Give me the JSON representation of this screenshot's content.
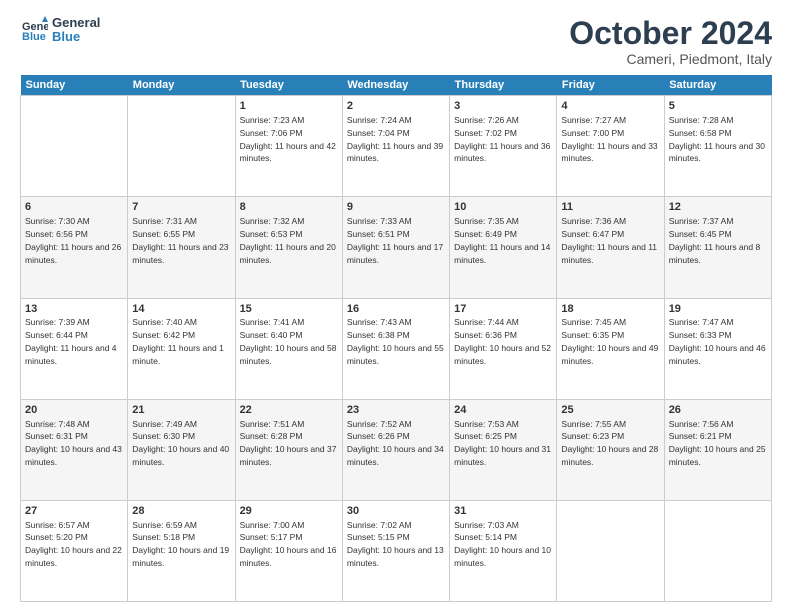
{
  "header": {
    "logo_line1": "General",
    "logo_line2": "Blue",
    "month_year": "October 2024",
    "location": "Cameri, Piedmont, Italy"
  },
  "weekdays": [
    "Sunday",
    "Monday",
    "Tuesday",
    "Wednesday",
    "Thursday",
    "Friday",
    "Saturday"
  ],
  "weeks": [
    [
      {
        "day": "",
        "sunrise": "",
        "sunset": "",
        "daylight": ""
      },
      {
        "day": "",
        "sunrise": "",
        "sunset": "",
        "daylight": ""
      },
      {
        "day": "1",
        "sunrise": "Sunrise: 7:23 AM",
        "sunset": "Sunset: 7:06 PM",
        "daylight": "Daylight: 11 hours and 42 minutes."
      },
      {
        "day": "2",
        "sunrise": "Sunrise: 7:24 AM",
        "sunset": "Sunset: 7:04 PM",
        "daylight": "Daylight: 11 hours and 39 minutes."
      },
      {
        "day": "3",
        "sunrise": "Sunrise: 7:26 AM",
        "sunset": "Sunset: 7:02 PM",
        "daylight": "Daylight: 11 hours and 36 minutes."
      },
      {
        "day": "4",
        "sunrise": "Sunrise: 7:27 AM",
        "sunset": "Sunset: 7:00 PM",
        "daylight": "Daylight: 11 hours and 33 minutes."
      },
      {
        "day": "5",
        "sunrise": "Sunrise: 7:28 AM",
        "sunset": "Sunset: 6:58 PM",
        "daylight": "Daylight: 11 hours and 30 minutes."
      }
    ],
    [
      {
        "day": "6",
        "sunrise": "Sunrise: 7:30 AM",
        "sunset": "Sunset: 6:56 PM",
        "daylight": "Daylight: 11 hours and 26 minutes."
      },
      {
        "day": "7",
        "sunrise": "Sunrise: 7:31 AM",
        "sunset": "Sunset: 6:55 PM",
        "daylight": "Daylight: 11 hours and 23 minutes."
      },
      {
        "day": "8",
        "sunrise": "Sunrise: 7:32 AM",
        "sunset": "Sunset: 6:53 PM",
        "daylight": "Daylight: 11 hours and 20 minutes."
      },
      {
        "day": "9",
        "sunrise": "Sunrise: 7:33 AM",
        "sunset": "Sunset: 6:51 PM",
        "daylight": "Daylight: 11 hours and 17 minutes."
      },
      {
        "day": "10",
        "sunrise": "Sunrise: 7:35 AM",
        "sunset": "Sunset: 6:49 PM",
        "daylight": "Daylight: 11 hours and 14 minutes."
      },
      {
        "day": "11",
        "sunrise": "Sunrise: 7:36 AM",
        "sunset": "Sunset: 6:47 PM",
        "daylight": "Daylight: 11 hours and 11 minutes."
      },
      {
        "day": "12",
        "sunrise": "Sunrise: 7:37 AM",
        "sunset": "Sunset: 6:45 PM",
        "daylight": "Daylight: 11 hours and 8 minutes."
      }
    ],
    [
      {
        "day": "13",
        "sunrise": "Sunrise: 7:39 AM",
        "sunset": "Sunset: 6:44 PM",
        "daylight": "Daylight: 11 hours and 4 minutes."
      },
      {
        "day": "14",
        "sunrise": "Sunrise: 7:40 AM",
        "sunset": "Sunset: 6:42 PM",
        "daylight": "Daylight: 11 hours and 1 minute."
      },
      {
        "day": "15",
        "sunrise": "Sunrise: 7:41 AM",
        "sunset": "Sunset: 6:40 PM",
        "daylight": "Daylight: 10 hours and 58 minutes."
      },
      {
        "day": "16",
        "sunrise": "Sunrise: 7:43 AM",
        "sunset": "Sunset: 6:38 PM",
        "daylight": "Daylight: 10 hours and 55 minutes."
      },
      {
        "day": "17",
        "sunrise": "Sunrise: 7:44 AM",
        "sunset": "Sunset: 6:36 PM",
        "daylight": "Daylight: 10 hours and 52 minutes."
      },
      {
        "day": "18",
        "sunrise": "Sunrise: 7:45 AM",
        "sunset": "Sunset: 6:35 PM",
        "daylight": "Daylight: 10 hours and 49 minutes."
      },
      {
        "day": "19",
        "sunrise": "Sunrise: 7:47 AM",
        "sunset": "Sunset: 6:33 PM",
        "daylight": "Daylight: 10 hours and 46 minutes."
      }
    ],
    [
      {
        "day": "20",
        "sunrise": "Sunrise: 7:48 AM",
        "sunset": "Sunset: 6:31 PM",
        "daylight": "Daylight: 10 hours and 43 minutes."
      },
      {
        "day": "21",
        "sunrise": "Sunrise: 7:49 AM",
        "sunset": "Sunset: 6:30 PM",
        "daylight": "Daylight: 10 hours and 40 minutes."
      },
      {
        "day": "22",
        "sunrise": "Sunrise: 7:51 AM",
        "sunset": "Sunset: 6:28 PM",
        "daylight": "Daylight: 10 hours and 37 minutes."
      },
      {
        "day": "23",
        "sunrise": "Sunrise: 7:52 AM",
        "sunset": "Sunset: 6:26 PM",
        "daylight": "Daylight: 10 hours and 34 minutes."
      },
      {
        "day": "24",
        "sunrise": "Sunrise: 7:53 AM",
        "sunset": "Sunset: 6:25 PM",
        "daylight": "Daylight: 10 hours and 31 minutes."
      },
      {
        "day": "25",
        "sunrise": "Sunrise: 7:55 AM",
        "sunset": "Sunset: 6:23 PM",
        "daylight": "Daylight: 10 hours and 28 minutes."
      },
      {
        "day": "26",
        "sunrise": "Sunrise: 7:56 AM",
        "sunset": "Sunset: 6:21 PM",
        "daylight": "Daylight: 10 hours and 25 minutes."
      }
    ],
    [
      {
        "day": "27",
        "sunrise": "Sunrise: 6:57 AM",
        "sunset": "Sunset: 5:20 PM",
        "daylight": "Daylight: 10 hours and 22 minutes."
      },
      {
        "day": "28",
        "sunrise": "Sunrise: 6:59 AM",
        "sunset": "Sunset: 5:18 PM",
        "daylight": "Daylight: 10 hours and 19 minutes."
      },
      {
        "day": "29",
        "sunrise": "Sunrise: 7:00 AM",
        "sunset": "Sunset: 5:17 PM",
        "daylight": "Daylight: 10 hours and 16 minutes."
      },
      {
        "day": "30",
        "sunrise": "Sunrise: 7:02 AM",
        "sunset": "Sunset: 5:15 PM",
        "daylight": "Daylight: 10 hours and 13 minutes."
      },
      {
        "day": "31",
        "sunrise": "Sunrise: 7:03 AM",
        "sunset": "Sunset: 5:14 PM",
        "daylight": "Daylight: 10 hours and 10 minutes."
      },
      {
        "day": "",
        "sunrise": "",
        "sunset": "",
        "daylight": ""
      },
      {
        "day": "",
        "sunrise": "",
        "sunset": "",
        "daylight": ""
      }
    ]
  ]
}
